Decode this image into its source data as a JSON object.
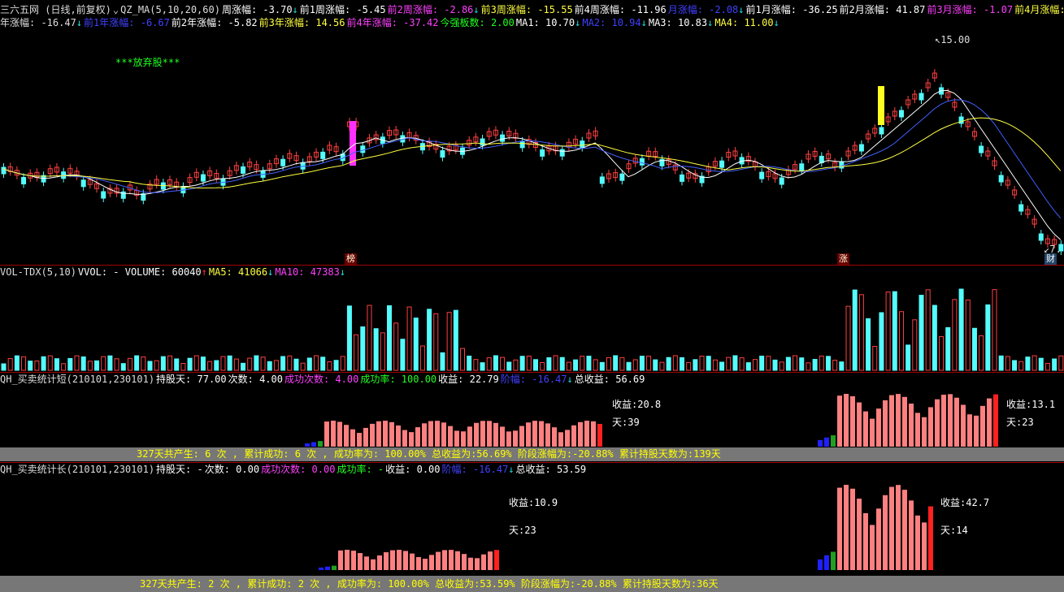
{
  "colors": {
    "up": "#ff4040",
    "down": "#54fcfc",
    "ma5": "#ffffff",
    "ma10": "#ffff40",
    "ma20": "#ff40ff",
    "ma60": "#20ff20",
    "bg": "#000000",
    "grid": "#a00000"
  },
  "main_header_line1": [
    {
      "text": "三六五网 (日线,前复权)",
      "color": "#dddddd"
    },
    {
      "text": "⌄",
      "color": "#cccccc"
    },
    {
      "text": "QZ_MA(5,10,20,60)",
      "color": "#dddddd"
    },
    {
      "text": "周涨幅: -3.70",
      "color": "#ffffff",
      "arrow": "down"
    },
    {
      "text": "前1周涨幅: -5.45",
      "color": "#ffffff"
    },
    {
      "text": "前2周涨幅: -2.86",
      "color": "#ff40ff",
      "arrow": "down"
    },
    {
      "text": "前3周涨幅: -15.55",
      "color": "#ffff40"
    },
    {
      "text": "前4周涨幅: -11.96",
      "color": "#ffffff"
    },
    {
      "text": "月涨幅: -2.08",
      "color": "#4040ff",
      "arrow": "down"
    },
    {
      "text": "前1月涨幅: -36.25",
      "color": "#ffffff"
    },
    {
      "text": "前2月涨幅: 41.87",
      "color": "#ffffff"
    },
    {
      "text": "前3月涨幅: -1.07",
      "color": "#ff40ff"
    },
    {
      "text": "前4月涨幅: -9.76",
      "color": "#ffff40"
    }
  ],
  "main_header_line2": [
    {
      "text": "年涨幅: -16.47",
      "color": "#dddddd",
      "arrow": "down"
    },
    {
      "text": "前1年涨幅: -6.67",
      "color": "#4040ff"
    },
    {
      "text": "前2年涨幅: -5.82",
      "color": "#ffffff"
    },
    {
      "text": "前3年涨幅: 14.56",
      "color": "#ffff40"
    },
    {
      "text": "前4年涨幅: -37.42",
      "color": "#ff40ff"
    },
    {
      "text": "今强板数: 2.00",
      "color": "#20ff20"
    },
    {
      "text": "MA1: 10.70",
      "color": "#ffffff",
      "arrow": "down"
    },
    {
      "text": "MA2: 10.94",
      "color": "#4040ff",
      "arrow": "down"
    },
    {
      "text": "MA3: 10.83",
      "color": "#ffffff",
      "arrow": "down"
    },
    {
      "text": "MA4: 11.00",
      "color": "#ffff40",
      "arrow": "down"
    }
  ],
  "main_annotations": {
    "abandon_label": "***放弃股***",
    "high_price": "15.00",
    "low_price": "7.",
    "tag_bang": "榜",
    "tag_zhang": "涨",
    "tag_cai": "财"
  },
  "vol_header": [
    {
      "text": "VOL-TDX(5,10)",
      "color": "#dddddd"
    },
    {
      "text": "VVOL: - VOLUME: 60040",
      "color": "#ffffff",
      "arrow": "up"
    },
    {
      "text": "MA5: 41066",
      "color": "#ffff40",
      "arrow": "down"
    },
    {
      "text": "MA10: 47383",
      "color": "#ff40ff",
      "arrow": "down"
    }
  ],
  "short_header": [
    {
      "text": "QH_买卖统计短(210101,230101)",
      "color": "#dddddd"
    },
    {
      "text": "持股天: 77.00",
      "color": "#ffffff"
    },
    {
      "text": "次数: 4.00",
      "color": "#ffffff"
    },
    {
      "text": "成功次数: 4.00",
      "color": "#ff40ff"
    },
    {
      "text": "成功率: 100.00",
      "color": "#20ff20"
    },
    {
      "text": "收益: 22.79",
      "color": "#ffffff"
    },
    {
      "text": "阶幅: -16.47",
      "color": "#4040ff",
      "arrow": "down"
    },
    {
      "text": "总收益: 56.69",
      "color": "#ffffff"
    }
  ],
  "short_annotations": {
    "profit1": "收益:20.8",
    "days1": "天:39",
    "profit2": "收益:13.1",
    "days2": "天:23"
  },
  "short_status": "327天共产生: 6 次 , 累计成功: 6 次 , 成功率为: 100.00% 总收益为:56.69% 阶段涨幅为:-20.88% 累计持股天数为:139天",
  "long_header": [
    {
      "text": "QH_买卖统计长(210101,230101)",
      "color": "#dddddd"
    },
    {
      "text": "持股天: -",
      "color": "#ffffff"
    },
    {
      "text": "次数: 0.00",
      "color": "#ffffff"
    },
    {
      "text": "成功次数: 0.00",
      "color": "#ff40ff"
    },
    {
      "text": "成功率: -",
      "color": "#20ff20"
    },
    {
      "text": "收益: 0.00",
      "color": "#ffffff"
    },
    {
      "text": "阶幅: -16.47",
      "color": "#4040ff",
      "arrow": "down"
    },
    {
      "text": "总收益: 53.59",
      "color": "#ffffff"
    }
  ],
  "long_annotations": {
    "profit1": "收益:10.9",
    "days1": "天:23",
    "profit2": "收益:42.7",
    "days2": "天:14"
  },
  "long_status": "327天共产生: 2 次 , 累计成功: 2 次 , 成功率为: 100.00% 总收益为:53.59% 阶段涨幅为:-20.88% 累计持股天数为:36天"
}
